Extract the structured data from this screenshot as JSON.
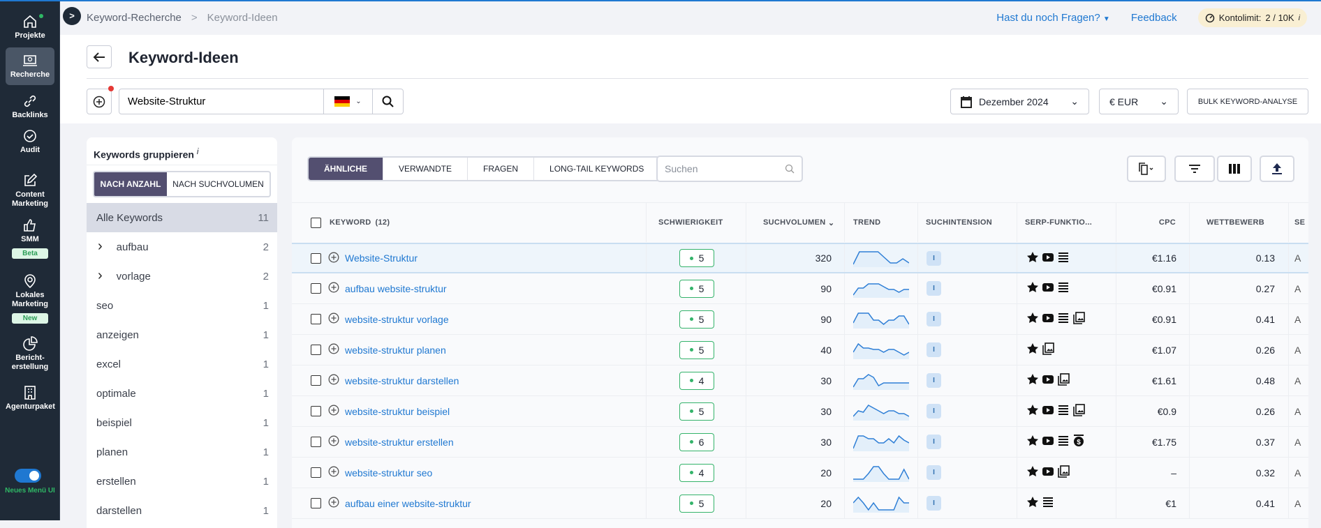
{
  "nav": {
    "items": [
      {
        "label": "Projekte",
        "icon": "home-icon"
      },
      {
        "label": "Recherche",
        "icon": "research-icon",
        "active": true
      },
      {
        "label": "Backlinks",
        "icon": "link-icon"
      },
      {
        "label": "Audit",
        "icon": "check-circle-icon"
      },
      {
        "label": "Content Marketing",
        "icon": "edit-icon"
      },
      {
        "label": "SMM",
        "icon": "thumbs-up-icon",
        "badge": "Beta"
      },
      {
        "label": "Lokales Marketing",
        "icon": "location-pin-icon",
        "badge": "New"
      },
      {
        "label": "Bericht-erstellung",
        "icon": "pie-chart-icon"
      },
      {
        "label": "Agenturpaket",
        "icon": "building-icon"
      }
    ],
    "toggle_label": "Neues Menü UI",
    "toggle_on": true
  },
  "breadcrumb": [
    "Keyword-Recherche",
    "Keyword-Ideen"
  ],
  "top": {
    "help": "Hast du noch Fragen?",
    "feedback": "Feedback",
    "limit_label": "Kontolimit:",
    "limit_value": "2 / 10K",
    "info": "i"
  },
  "header": {
    "title": "Keyword-Ideen",
    "search_value": "Website-Struktur",
    "country": "DE",
    "date": "Dezember 2024",
    "currency": "€ EUR",
    "bulk": "BULK KEYWORD-ANALYSE"
  },
  "groups": {
    "title": "Keywords gruppieren",
    "info": "i",
    "modes": [
      "NACH ANZAHL",
      "NACH SUCHVOLUMEN"
    ],
    "active_mode": 0,
    "items": [
      {
        "label": "Alle Keywords",
        "count": "11",
        "active": true
      },
      {
        "label": "aufbau",
        "count": "2",
        "expandable": true
      },
      {
        "label": "vorlage",
        "count": "2",
        "expandable": true
      },
      {
        "label": "seo",
        "count": "1"
      },
      {
        "label": "anzeigen",
        "count": "1"
      },
      {
        "label": "excel",
        "count": "1"
      },
      {
        "label": "optimale",
        "count": "1"
      },
      {
        "label": "beispiel",
        "count": "1"
      },
      {
        "label": "planen",
        "count": "1"
      },
      {
        "label": "erstellen",
        "count": "1"
      },
      {
        "label": "darstellen",
        "count": "1"
      }
    ]
  },
  "tabs": [
    "ÄHNLICHE",
    "VERWANDTE",
    "FRAGEN",
    "LONG-TAIL KEYWORDS"
  ],
  "active_tab": 0,
  "table_search_placeholder": "Suchen",
  "columns": {
    "keyword": "KEYWORD",
    "keyword_count": "(12)",
    "difficulty": "SCHWIERIGKEIT",
    "volume": "SUCHVOLUMEN",
    "trend": "TREND",
    "intent": "SUCHINTENSION",
    "serp": "SERP-FUNKTIO...",
    "cpc": "CPC",
    "competition": "WETTBEWERB",
    "more": "SE"
  },
  "rows": [
    {
      "keyword": "Website-Struktur",
      "difficulty": "5",
      "volume": "320",
      "trend": [
        10,
        100,
        100,
        100,
        100,
        60,
        20,
        20,
        50,
        20
      ],
      "intent": "I",
      "serp": [
        "star",
        "video",
        "list"
      ],
      "cpc": "€1.16",
      "competition": "0.13"
    },
    {
      "keyword": "aufbau website-struktur",
      "difficulty": "5",
      "volume": "90",
      "trend": [
        10,
        60,
        60,
        90,
        90,
        90,
        70,
        50,
        50,
        30,
        50,
        50
      ],
      "intent": "I",
      "serp": [
        "star",
        "video",
        "list"
      ],
      "cpc": "€0.91",
      "competition": "0.27"
    },
    {
      "keyword": "website-struktur vorlage",
      "difficulty": "5",
      "volume": "90",
      "trend": [
        30,
        100,
        100,
        100,
        50,
        50,
        20,
        50,
        50,
        80,
        80,
        20
      ],
      "intent": "I",
      "serp": [
        "star",
        "video",
        "list",
        "images"
      ],
      "cpc": "€0.91",
      "competition": "0.41"
    },
    {
      "keyword": "website-struktur planen",
      "difficulty": "5",
      "volume": "40",
      "trend": [
        40,
        100,
        70,
        70,
        60,
        60,
        40,
        60,
        60,
        40,
        20,
        40
      ],
      "intent": "I",
      "serp": [
        "star",
        "images"
      ],
      "cpc": "€1.07",
      "competition": "0.26"
    },
    {
      "keyword": "website-struktur darstellen",
      "difficulty": "4",
      "volume": "30",
      "trend": [
        10,
        70,
        70,
        100,
        80,
        20,
        40,
        40,
        40,
        40,
        40,
        40
      ],
      "intent": "I",
      "serp": [
        "star",
        "video",
        "images"
      ],
      "cpc": "€1.61",
      "competition": "0.48"
    },
    {
      "keyword": "website-struktur beispiel",
      "difficulty": "5",
      "volume": "30",
      "trend": [
        20,
        60,
        50,
        100,
        80,
        60,
        40,
        60,
        60,
        40,
        40,
        20
      ],
      "intent": "I",
      "serp": [
        "star",
        "video",
        "list",
        "images"
      ],
      "cpc": "€0.9",
      "competition": "0.26"
    },
    {
      "keyword": "website-struktur erstellen",
      "difficulty": "6",
      "volume": "30",
      "trend": [
        10,
        100,
        100,
        80,
        80,
        50,
        50,
        80,
        50,
        100,
        70,
        50
      ],
      "intent": "I",
      "serp": [
        "star",
        "video",
        "list",
        "dollar"
      ],
      "cpc": "€1.75",
      "competition": "0.37"
    },
    {
      "keyword": "website-struktur seo",
      "difficulty": "4",
      "volume": "20",
      "trend": [
        10,
        10,
        10,
        50,
        100,
        100,
        50,
        10,
        10,
        10,
        80,
        10
      ],
      "intent": "I",
      "serp": [
        "star",
        "video",
        "images"
      ],
      "cpc": "–",
      "competition": "0.32"
    },
    {
      "keyword": "aufbau einer website-struktur",
      "difficulty": "5",
      "volume": "20",
      "trend": [
        60,
        100,
        60,
        10,
        60,
        10,
        10,
        10,
        10,
        100,
        60,
        60
      ],
      "intent": "I",
      "serp": [
        "star",
        "list"
      ],
      "cpc": "€1",
      "competition": "0.41"
    }
  ],
  "colors": {
    "accent": "#1f78d1",
    "nav_bg": "#1f2a37",
    "active_tab": "#534f70",
    "difficulty_green": "#34b36a"
  }
}
